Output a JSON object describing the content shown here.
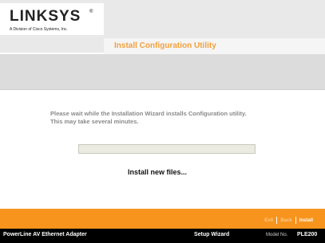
{
  "header": {
    "logo_text": "LINKSYS",
    "logo_mark": "®",
    "logo_subtitle": "A Division of Cisco Systems, Inc.",
    "page_title": "Install Configuration Utility"
  },
  "main": {
    "message_line1": "Please wait while the Installation Wizard installs Configuration utility.",
    "message_line2": "This may take several minutes.",
    "progress": 0.0,
    "status_text": "Install new files..."
  },
  "nav": {
    "exit_label": "Exit",
    "back_label": "Back",
    "install_label": "Install"
  },
  "footer": {
    "product_name": "PowerLine AV Ethernet Adapter",
    "wizard_name": "Setup Wizard",
    "model_label": "Model No.",
    "model_number": "PLE200"
  },
  "colors": {
    "accent_orange": "#f7941d",
    "title_orange": "#f2a03d",
    "footer_black": "#000000"
  }
}
